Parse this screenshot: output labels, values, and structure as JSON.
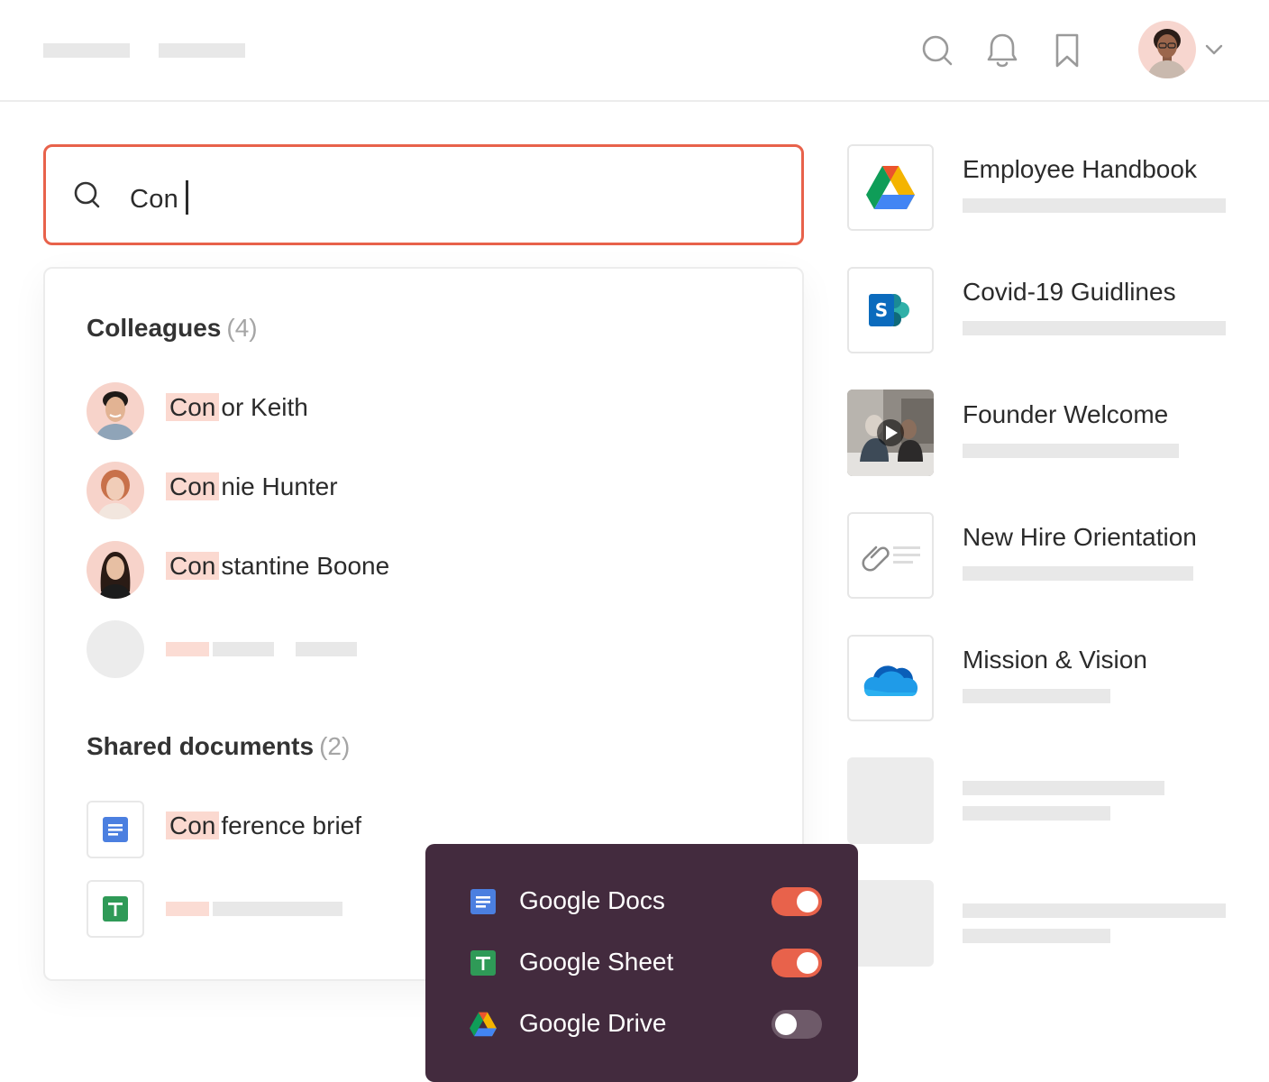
{
  "search": {
    "query": "Con"
  },
  "colleagues": {
    "title": "Colleagues",
    "count": "(4)",
    "items": [
      {
        "match": "Con",
        "rest": "or Keith"
      },
      {
        "match": "Con",
        "rest": "nie Hunter"
      },
      {
        "match": "Con",
        "rest": "stantine Boone"
      }
    ]
  },
  "shared_documents": {
    "title": "Shared documents",
    "count": "(2)",
    "items": [
      {
        "match": "Con",
        "rest": "ference brief",
        "icon": "google-docs-icon"
      }
    ]
  },
  "recent": [
    {
      "title": "Employee Handbook",
      "icon": "google-drive-icon"
    },
    {
      "title": "Covid-19 Guidlines",
      "icon": "sharepoint-icon"
    },
    {
      "title": "Founder Welcome",
      "icon": "video-thumbnail"
    },
    {
      "title": "New Hire Orientation",
      "icon": "attachment-icon"
    },
    {
      "title": "Mission & Vision",
      "icon": "onedrive-icon"
    }
  ],
  "filters": [
    {
      "label": "Google Docs",
      "enabled": true
    },
    {
      "label": "Google Sheet",
      "enabled": true
    },
    {
      "label": "Google Drive",
      "enabled": false
    }
  ],
  "colors": {
    "accent": "#e8624b",
    "popover": "#432b3e",
    "highlight": "#fbd9d0"
  }
}
